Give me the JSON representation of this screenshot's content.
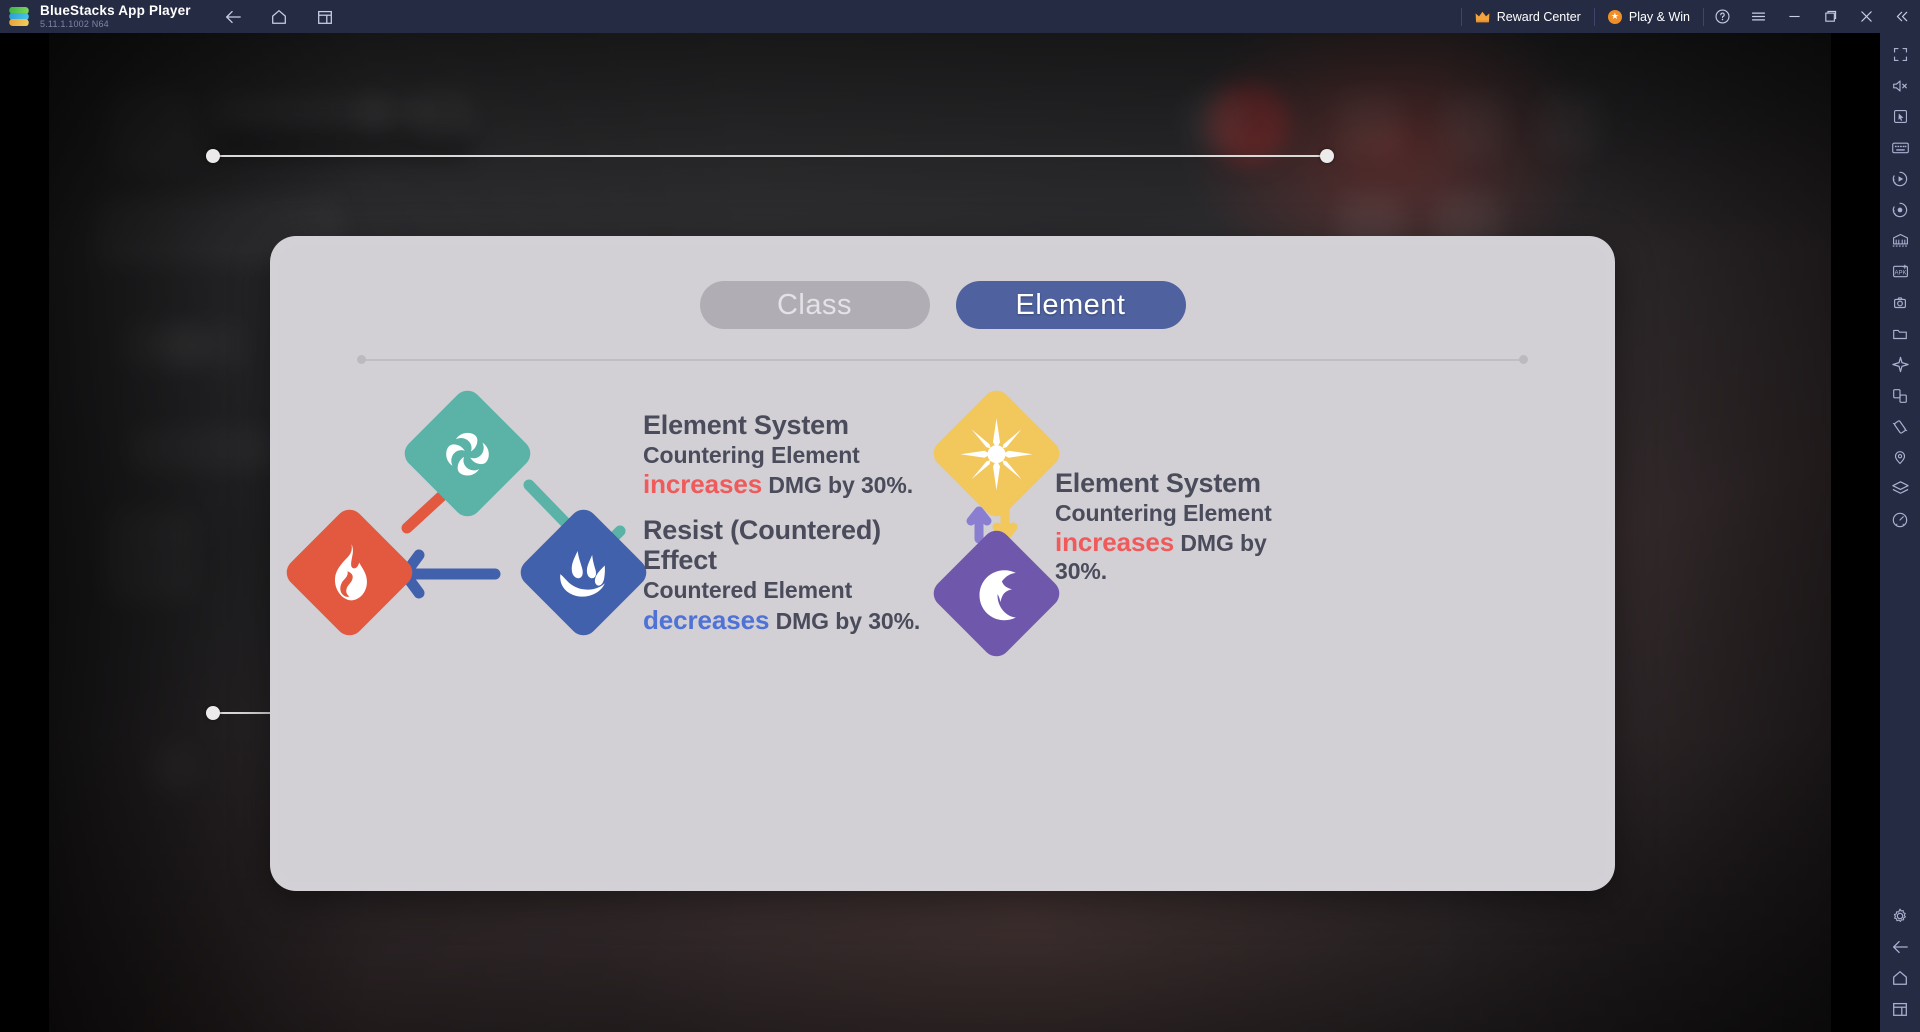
{
  "titlebar": {
    "app_name": "BlueStacks App Player",
    "version": "5.11.1.1002  N64",
    "logo_icon": "bluestacks-logo",
    "nav": [
      {
        "name": "back-icon",
        "label": "Back"
      },
      {
        "name": "home-icon",
        "label": "Home"
      },
      {
        "name": "recents-icon",
        "label": "Recent apps"
      }
    ],
    "reward_center": "Reward Center",
    "reward_icon": "crown-icon",
    "play_and_win": "Play & Win",
    "play_icon": "star-badge-icon",
    "help_icon": "help-circle-icon",
    "menu_icon": "hamburger-menu-icon",
    "minimize_icon": "minimize-icon",
    "maximize_icon": "maximize-icon",
    "close_icon": "close-icon",
    "collapse_icon": "double-chevron-left-icon",
    "bg_color": "#262b44"
  },
  "sidebar": {
    "items": [
      {
        "name": "fullscreen-icon",
        "label": "Full screen"
      },
      {
        "name": "mute-icon",
        "label": "Mute"
      },
      {
        "name": "cursor-icon",
        "label": "Pointer"
      },
      {
        "name": "keyboard-icon",
        "label": "Game controls"
      },
      {
        "name": "macro-play-icon",
        "label": "Macro recorder"
      },
      {
        "name": "record-icon",
        "label": "Record screen"
      },
      {
        "name": "multi-instance-icon",
        "label": "Multi-instance manager"
      },
      {
        "name": "install-apk-icon",
        "label": "Install APK"
      },
      {
        "name": "screenshot-icon",
        "label": "Screenshot"
      },
      {
        "name": "folder-icon",
        "label": "Media manager"
      },
      {
        "name": "eco-mode-icon",
        "label": "Eco mode"
      },
      {
        "name": "rotate-icon",
        "label": "Rotate"
      },
      {
        "name": "shake-icon",
        "label": "Shake"
      },
      {
        "name": "location-icon",
        "label": "Location"
      },
      {
        "name": "layers-icon",
        "label": "Sync operations"
      },
      {
        "name": "performance-icon",
        "label": "Performance"
      }
    ],
    "bottom_items": [
      {
        "name": "settings-gear-icon",
        "label": "Settings"
      },
      {
        "name": "back-icon",
        "label": "Back"
      },
      {
        "name": "home-icon",
        "label": "Home"
      },
      {
        "name": "recents-icon",
        "label": "Recent apps"
      }
    ],
    "bg_color": "#262b44"
  },
  "dialog": {
    "bg_color": "#d2cfd5",
    "tabs": [
      {
        "label": "Class",
        "active": false,
        "color": "#b0aeb4"
      },
      {
        "label": "Element",
        "active": true,
        "color": "#4f629f"
      }
    ],
    "left_panel": {
      "elements": [
        {
          "name": "wind-element",
          "icon": "wind-swirl-icon",
          "color": "#5bb2a7"
        },
        {
          "name": "fire-element",
          "icon": "flame-icon",
          "color": "#e2593f"
        },
        {
          "name": "water-element",
          "icon": "water-splash-icon",
          "color": "#4161ad"
        }
      ],
      "arrows": [
        {
          "name": "fire-to-wind-arrow",
          "color": "#e2593f"
        },
        {
          "name": "wind-to-water-arrow",
          "color": "#5bb2a7"
        },
        {
          "name": "water-to-fire-arrow",
          "color": "#4161ad"
        }
      ],
      "info": {
        "title": "Element System",
        "line1": "Countering Element",
        "highlight": "increases",
        "highlight_color": "#f05a5a",
        "line2_rest": " DMG by 30%."
      },
      "resist": {
        "title": "Resist (Countered) Effect",
        "line1": "Countered Element",
        "highlight": "decreases",
        "highlight_color": "#4f72d6",
        "line2_rest": " DMG by 30%."
      }
    },
    "right_panel": {
      "elements": [
        {
          "name": "light-element",
          "icon": "sunburst-icon",
          "color": "#f2c75c"
        },
        {
          "name": "dark-element",
          "icon": "crescent-sparkle-icon",
          "color": "#6f58ac"
        }
      ],
      "arrows": [
        {
          "name": "dark-up-arrow",
          "color": "#8a7ed0"
        },
        {
          "name": "light-down-arrow",
          "color": "#f2c75c"
        }
      ],
      "info": {
        "title": "Element System",
        "line1": "Countering Element",
        "highlight": "increases",
        "highlight_color": "#f05a5a",
        "line2_rest": " DMG by",
        "line3": "30%."
      }
    }
  },
  "selection": {
    "name": "selection-overlay",
    "handles": [
      "top-left-handle",
      "top-right-handle",
      "bottom-left-handle",
      "bottom-right-handle"
    ],
    "line_color": "#d9d9d9"
  }
}
